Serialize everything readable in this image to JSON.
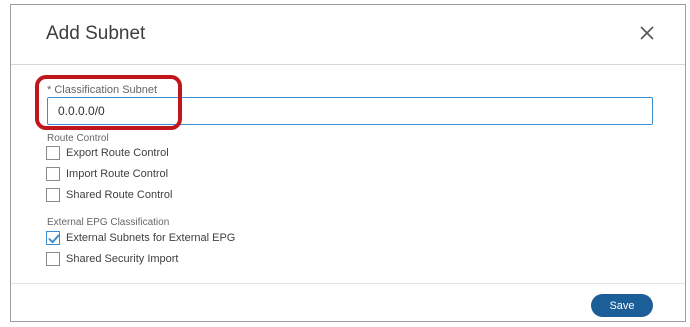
{
  "dialog": {
    "title": "Add Subnet"
  },
  "classification_subnet": {
    "label": "* Classification Subnet",
    "value": "0.0.0.0/0"
  },
  "route_control": {
    "title": "Route Control",
    "items": [
      {
        "label": "Export Route Control",
        "checked": false
      },
      {
        "label": "Import Route Control",
        "checked": false
      },
      {
        "label": "Shared Route Control",
        "checked": false
      }
    ]
  },
  "external_epg": {
    "title": "External EPG Classification",
    "items": [
      {
        "label": "External Subnets for External EPG",
        "checked": true
      },
      {
        "label": "Shared Security Import",
        "checked": false
      }
    ]
  },
  "footer": {
    "save_label": "Save"
  },
  "colors": {
    "accent": "#3d8fd1",
    "save_button": "#1b5e98",
    "highlight": "#c0161c"
  },
  "icons": {
    "close": "close-icon",
    "check": "checkmark-icon"
  }
}
